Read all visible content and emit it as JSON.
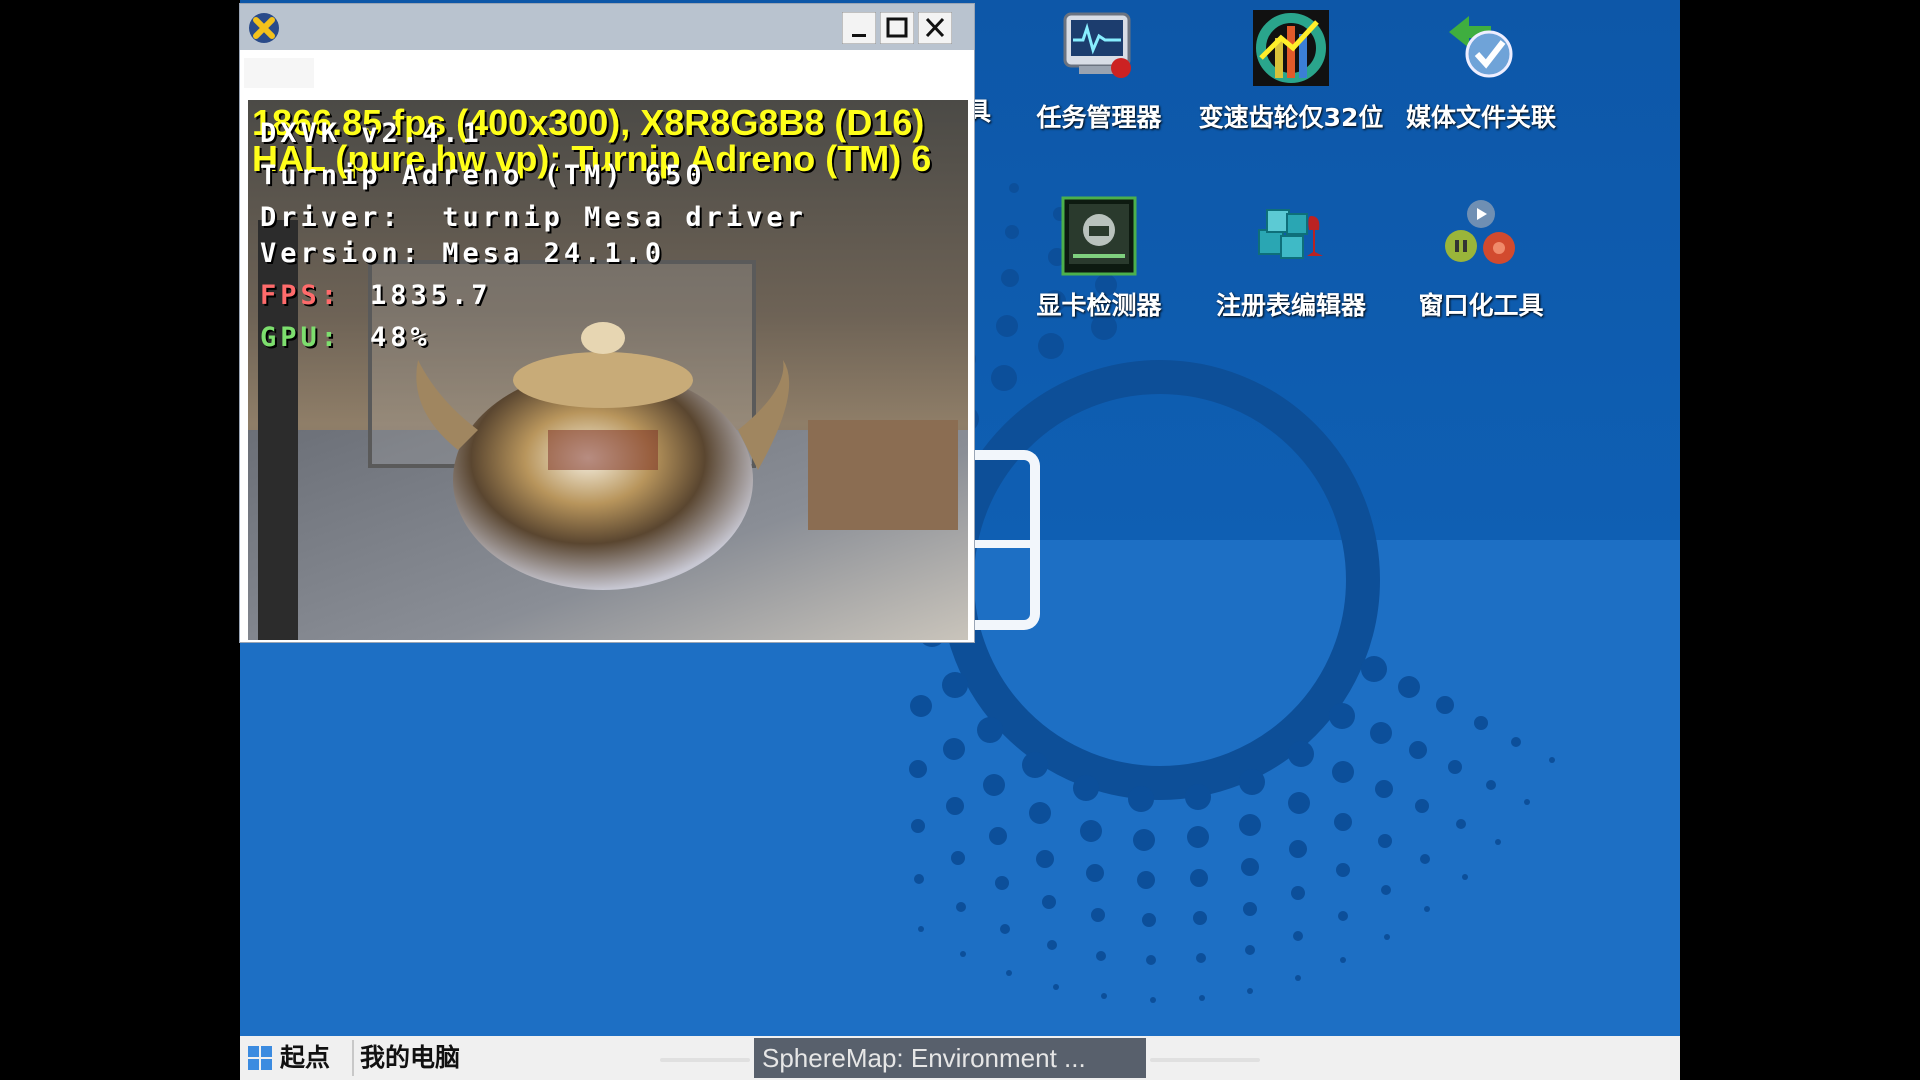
{
  "window": {
    "hud": {
      "line1": "1866.85 fps (400x300), X8R8G8B8 (D16)",
      "line2": "HAL (pure hw vp): Turnip Adreno (TM) 6",
      "dxvk": "DXVK v2.4.1",
      "device": "Turnip Adreno (TM) 650",
      "driver": "Driver:  turnip Mesa driver",
      "version": "Version: Mesa 24.1.0",
      "fps_label": "FPS:",
      "fps_value": "1835.7",
      "gpu_label": "GPU:",
      "gpu_value": "48%"
    }
  },
  "desktop": {
    "partial_label": "具",
    "icons": [
      {
        "label": "任务管理器",
        "icon": "task-manager-icon"
      },
      {
        "label": "变速齿轮仅32位",
        "icon": "speed-gear-icon"
      },
      {
        "label": "媒体文件关联",
        "icon": "media-association-icon"
      },
      {
        "label": "显卡检测器",
        "icon": "gpu-detector-icon"
      },
      {
        "label": "注册表编辑器",
        "icon": "registry-editor-icon"
      },
      {
        "label": "窗口化工具",
        "icon": "windowed-tool-icon"
      }
    ]
  },
  "taskbar": {
    "start_label": "起点",
    "mypc_label": "我的电脑",
    "active_task": "SphereMap: Environment ..."
  },
  "colors": {
    "desktop_blue": "#0f5fb3",
    "hud_yellow": "#ffff1a",
    "taskbar": "#f0f0f0"
  }
}
